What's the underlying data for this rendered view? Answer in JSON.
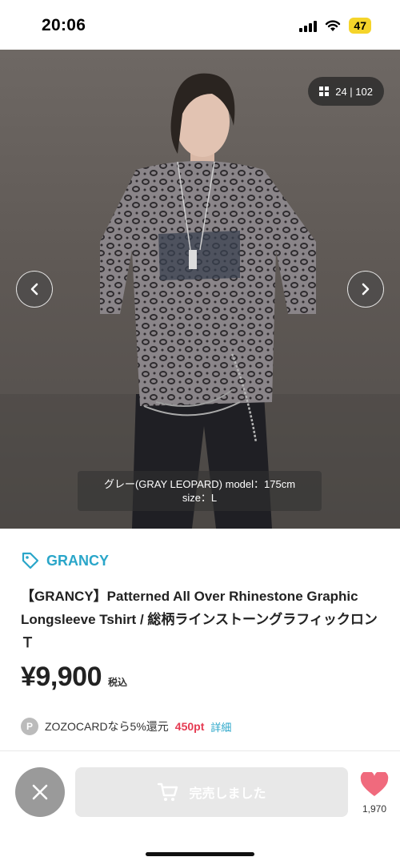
{
  "status_bar": {
    "time": "20:06",
    "battery": "47"
  },
  "gallery": {
    "counter": "24 | 102",
    "caption_line1": "グレー(GRAY LEOPARD) model：175cm",
    "caption_line2": "size：L",
    "prev_icon": "chevron-left-icon",
    "next_icon": "chevron-right-icon"
  },
  "product": {
    "brand": "GRANCY",
    "title": "【GRANCY】Patterned All Over Rhinestone Graphic Longsleeve Tshirt / 総柄ラインストーングラフィックロンＴ",
    "price": "¥9,900",
    "tax_label": "税込"
  },
  "points": {
    "badge": "P",
    "text": "ZOZOCARDなら5%還元",
    "value": "450pt",
    "link": "詳細"
  },
  "action_bar": {
    "soldout_label": "完売しました",
    "favorite_count": "1,970"
  },
  "colors": {
    "accent": "#2aa6c9",
    "points": "#e53b52",
    "heart": "#f06a7d"
  }
}
